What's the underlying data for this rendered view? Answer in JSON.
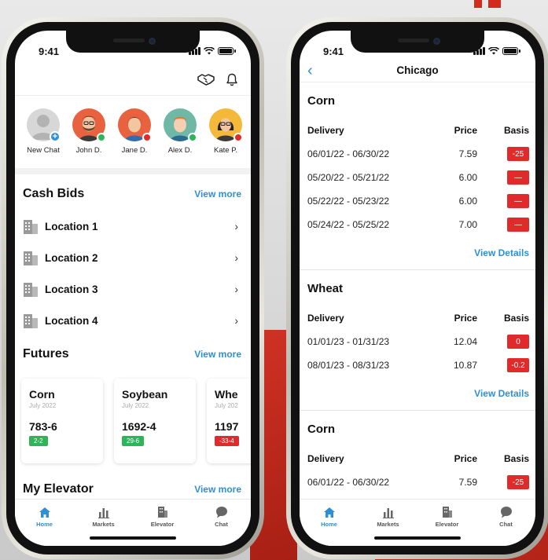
{
  "colors": {
    "accent": "#2f8fd1",
    "positive": "#2fb45a",
    "negative": "#e12a2a"
  },
  "left": {
    "status_time": "9:41",
    "chats": [
      {
        "name": "New Chat",
        "status": "add"
      },
      {
        "name": "John D.",
        "status": "online"
      },
      {
        "name": "Jane D.",
        "status": "busy"
      },
      {
        "name": "Alex D.",
        "status": "online"
      },
      {
        "name": "Kate P.",
        "status": "busy"
      }
    ],
    "cash_bids": {
      "title": "Cash Bids",
      "view_more": "View more",
      "locations": [
        "Location 1",
        "Location 2",
        "Location 3",
        "Location 4"
      ]
    },
    "futures": {
      "title": "Futures",
      "view_more": "View more",
      "cards": [
        {
          "name": "Corn",
          "date": "July 2022",
          "price": "783-6",
          "change": "2-2",
          "direction": "up"
        },
        {
          "name": "Soybean",
          "date": "July 2022",
          "price": "1692-4",
          "change": "29-6",
          "direction": "up"
        },
        {
          "name": "Whe",
          "date": "July 202",
          "price": "1197",
          "change": "-33-4",
          "direction": "down"
        }
      ]
    },
    "my_elevator": {
      "title": "My Elevator",
      "view_more": "View more"
    }
  },
  "tabs": [
    {
      "label": "Home",
      "icon": "home-icon"
    },
    {
      "label": "Markets",
      "icon": "bar-chart-icon"
    },
    {
      "label": "Elevator",
      "icon": "building-icon"
    },
    {
      "label": "Chat",
      "icon": "chat-bubble-icon"
    }
  ],
  "right": {
    "status_time": "9:41",
    "nav_title": "Chicago",
    "col_delivery": "Delivery",
    "col_price": "Price",
    "col_basis": "Basis",
    "view_details": "View Details",
    "blocks": [
      {
        "title": "Corn",
        "rows": [
          {
            "delivery": "06/01/22 - 06/30/22",
            "price": "7.59",
            "basis": "-25"
          },
          {
            "delivery": "05/20/22 - 05/21/22",
            "price": "6.00",
            "basis": "—"
          },
          {
            "delivery": "05/22/22 - 05/23/22",
            "price": "6.00",
            "basis": "—"
          },
          {
            "delivery": "05/24/22 - 05/25/22",
            "price": "7.00",
            "basis": "—"
          }
        ]
      },
      {
        "title": "Wheat",
        "rows": [
          {
            "delivery": "01/01/23 - 01/31/23",
            "price": "12.04",
            "basis": "0"
          },
          {
            "delivery": "08/01/23 - 08/31/23",
            "price": "10.87",
            "basis": "-0.2"
          }
        ]
      },
      {
        "title": "Corn",
        "rows": [
          {
            "delivery": "06/01/22 - 06/30/22",
            "price": "7.59",
            "basis": "-25"
          }
        ]
      }
    ]
  }
}
